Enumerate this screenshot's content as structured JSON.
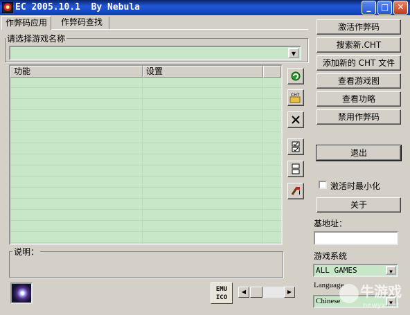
{
  "window": {
    "title": "EC 2005.10.1  By Nebula",
    "minimize": "_",
    "maximize": "□",
    "close": "✕"
  },
  "tabs": [
    {
      "label": "作弊码应用",
      "active": true
    },
    {
      "label": "作弊码查找",
      "active": false
    }
  ],
  "game_select": {
    "label": "请选择游戏名称",
    "value": ""
  },
  "cheat_list": {
    "columns": [
      "功能",
      "设置"
    ]
  },
  "tool_icons": [
    "refresh-icon",
    "open-cht-icon",
    "delete-icon",
    "check-all-icon",
    "uncheck-all-icon",
    "edit-icon"
  ],
  "tool_icon_labels": {
    "cht": "CHT"
  },
  "description": {
    "label": "说明：",
    "text": ""
  },
  "actions": {
    "activate": "激活作弊码",
    "search_cht": "搜索新.CHT",
    "add_cht": "添加新的 CHT 文件",
    "view_map": "查看游戏图",
    "view_guide": "查看功略",
    "disable": "禁用作弊码",
    "exit": "退出",
    "about": "关于"
  },
  "minimize_on_activate": {
    "label": "激活时最小化",
    "checked": false
  },
  "base_address": {
    "label": "基地址：",
    "value": ""
  },
  "game_system": {
    "label": "游戏系统",
    "value": "ALL GAMES"
  },
  "language": {
    "label": "Language",
    "value": "Chinese"
  },
  "emu_ico": {
    "line1": "EMU",
    "line2": "ICO"
  },
  "watermark": {
    "text": "牛游戏",
    "url": "newyx.net"
  },
  "colors": {
    "list_bg": "#c8e6c8",
    "title_bar": "#0b3fb5",
    "face": "#d4d0c8"
  }
}
